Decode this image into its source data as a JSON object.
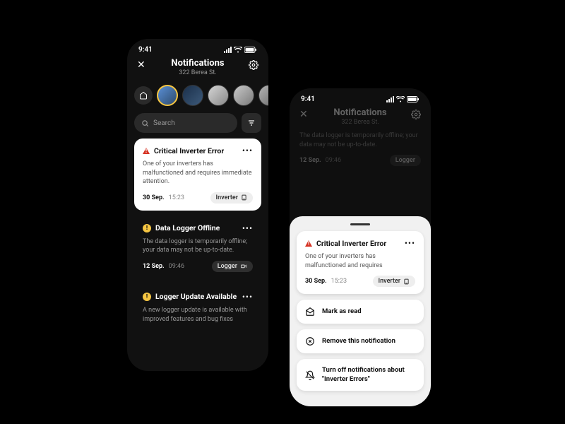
{
  "status_time": "9:41",
  "page": {
    "title": "Notifications",
    "subtitle": "322 Berea St."
  },
  "search": {
    "placeholder": "Search"
  },
  "notifications": [
    {
      "title": "Critical Inverter Error",
      "body": "One of your inverters has malfunctioned and requires immediate attention.",
      "body_short": "One of your inverters has malfunctioned and requires",
      "date": "30 Sep.",
      "time": "15:23",
      "chip": "Inverter",
      "severity": "critical"
    },
    {
      "title": "Data Logger Offline",
      "body": "The data logger is temporarily offline; your data may not be up-to-date.",
      "date": "12 Sep.",
      "time": "09:46",
      "chip": "Logger",
      "severity": "warning"
    },
    {
      "title": "Logger Update Available",
      "body": "A new logger update is available with improved features and bug fixes",
      "severity": "warning"
    }
  ],
  "sheet_actions": {
    "mark_read": "Mark as read",
    "remove": "Remove this notification",
    "turn_off": "Turn off notifications about \"Inverter Errors\""
  }
}
